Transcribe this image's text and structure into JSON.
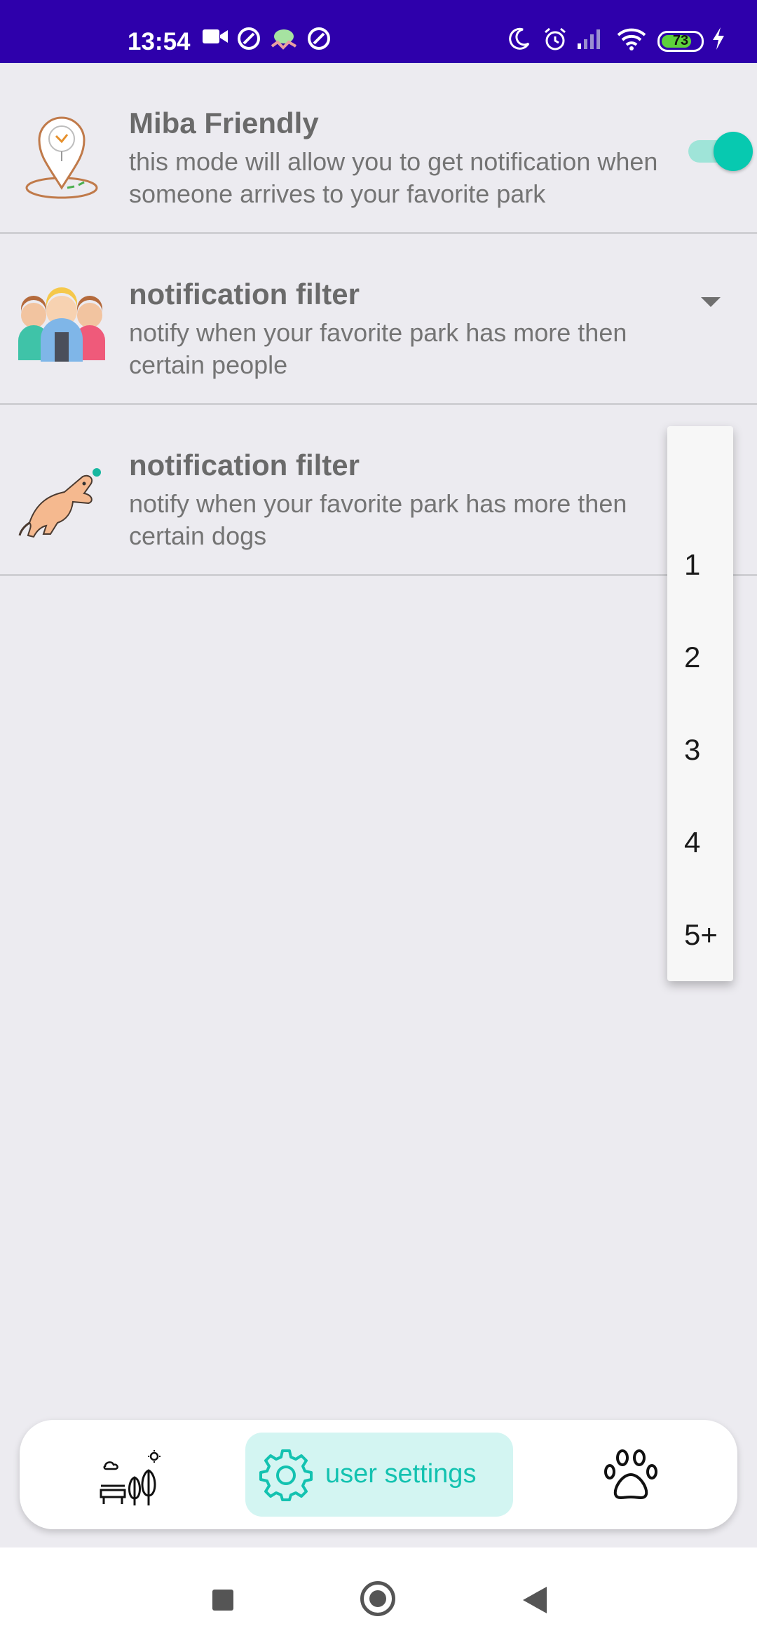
{
  "status_bar": {
    "time": "13:54",
    "battery": "73",
    "icons": [
      "video-camera-icon",
      "app-notification-icon",
      "alien-icon",
      "app-notification-icon",
      "moon-icon",
      "alarm-icon",
      "signal-icon",
      "wifi-icon",
      "battery-icon",
      "charging-icon"
    ]
  },
  "settings": [
    {
      "title": "Miba Friendly",
      "description": "this mode will allow you to get notification when someone arrives to your favorite park",
      "icon": "map-pin-icon",
      "control": "toggle",
      "toggle_on": true
    },
    {
      "title": "notification filter",
      "description": "notify when your favorite park has more then certain people",
      "icon": "people-icon",
      "control": "dropdown"
    },
    {
      "title": "notification filter",
      "description": "notify when your favorite park has more then certain dogs",
      "icon": "dog-icon",
      "control": "dropdown"
    }
  ],
  "popup_menu": {
    "options": [
      "",
      "1",
      "2",
      "3",
      "4",
      "5+"
    ]
  },
  "bottom_nav": {
    "items": [
      {
        "icon": "park-icon",
        "label": ""
      },
      {
        "icon": "gear-icon",
        "label": "user settings",
        "active": true
      },
      {
        "icon": "paw-icon",
        "label": ""
      }
    ]
  },
  "colors": {
    "status_bar": "#2e00ab",
    "accent": "#07c9b0",
    "background": "#ecebf0"
  }
}
